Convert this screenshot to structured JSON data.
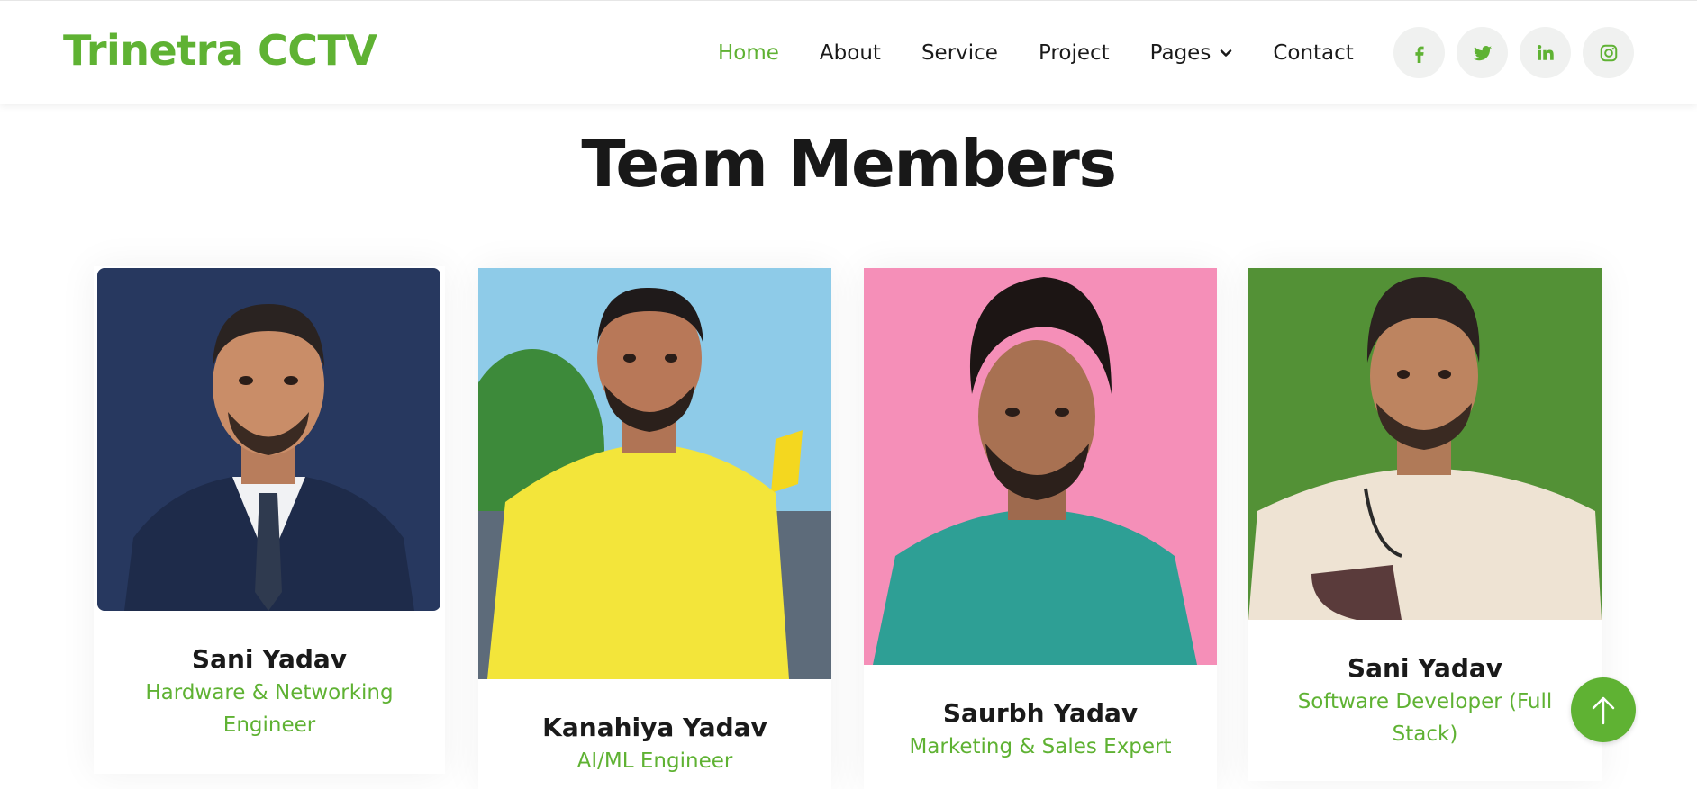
{
  "brand": {
    "name": "Trinetra CCTV",
    "color": "#5fb233"
  },
  "nav": {
    "items": [
      {
        "label": "Home",
        "active": true
      },
      {
        "label": "About",
        "active": false
      },
      {
        "label": "Service",
        "active": false
      },
      {
        "label": "Project",
        "active": false
      },
      {
        "label": "Pages",
        "active": false,
        "has_dropdown": true
      },
      {
        "label": "Contact",
        "active": false
      }
    ],
    "socials": [
      "facebook-icon",
      "twitter-icon",
      "linkedin-icon",
      "instagram-icon"
    ]
  },
  "section": {
    "title": "Team Members"
  },
  "team": [
    {
      "name": "Sani Yadav",
      "role": "Hardware & Networking Engineer",
      "photo_bg": "#27385f"
    },
    {
      "name": "Kanahiya Yadav",
      "role": "AI/ML Engineer",
      "photo_bg": "#8ecbe8"
    },
    {
      "name": "Saurbh Yadav",
      "role": "Marketing & Sales Expert",
      "photo_bg": "#f58fb8"
    },
    {
      "name": "Sani Yadav",
      "role": "Software Developer (Full Stack)",
      "photo_bg": "#4f8a32"
    }
  ],
  "back_to_top": {
    "icon": "arrow-up-icon"
  }
}
